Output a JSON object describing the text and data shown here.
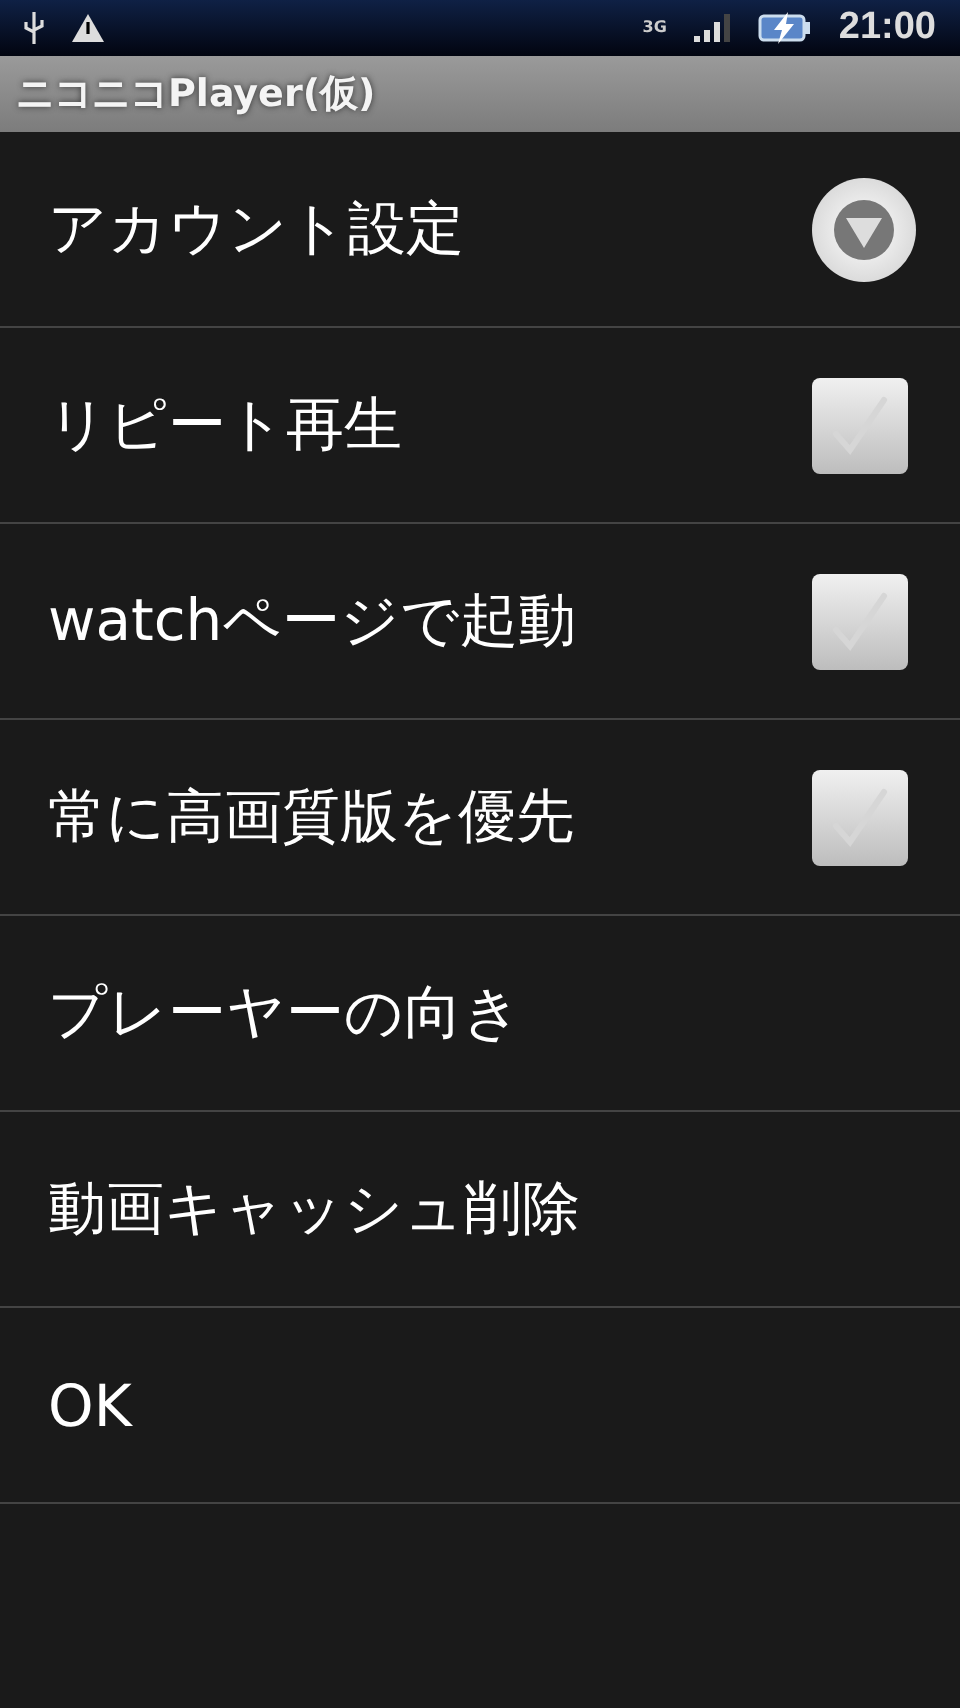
{
  "status_bar": {
    "time": "21:00",
    "network": "3G"
  },
  "title_bar": {
    "title": "ニコニコPlayer(仮)"
  },
  "items": [
    {
      "label": "アカウント設定",
      "kind": "dropdown"
    },
    {
      "label": "リピート再生",
      "kind": "checkbox",
      "checked": false
    },
    {
      "label": "watchページで起動",
      "kind": "checkbox",
      "checked": false
    },
    {
      "label": "常に高画質版を優先",
      "kind": "checkbox",
      "checked": false
    },
    {
      "label": "プレーヤーの向き",
      "kind": "plain"
    },
    {
      "label": "動画キャッシュ削除",
      "kind": "plain"
    },
    {
      "label": "OK",
      "kind": "plain"
    }
  ]
}
